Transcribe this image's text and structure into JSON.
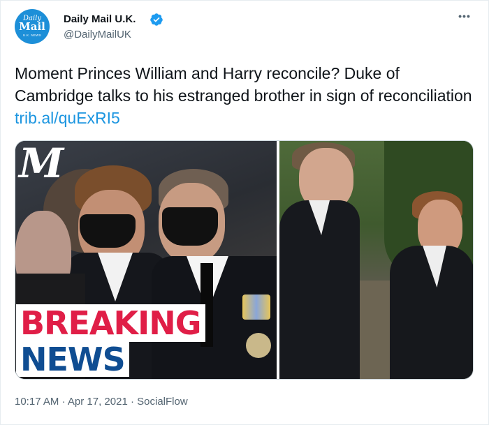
{
  "account": {
    "display_name": "Daily Mail U.K.",
    "handle": "@DailyMailUK",
    "avatar_line1": "Daily",
    "avatar_line2": "Mail",
    "avatar_line3": "U.K. NEWS",
    "verified_icon": "verified-badge-icon",
    "brand_color": "#1d8fd8"
  },
  "menu": {
    "more_label": "•••"
  },
  "tweet": {
    "text": "Moment Princes William and Harry reconcile? Duke of Cambridge talks to his estranged brother in sign of reconciliation ",
    "link": "trib.al/quExRI5",
    "link_color": "#1b95e0"
  },
  "media": {
    "logo": "M",
    "overlay_line1": "BREAKING",
    "overlay_line2": "NEWS",
    "overlay_line1_color": "#e01e47",
    "overlay_line2_color": "#0f4d92"
  },
  "meta": {
    "time": "10:17 AM",
    "date": "Apr 17, 2021",
    "source": "SocialFlow",
    "separator": "·"
  }
}
